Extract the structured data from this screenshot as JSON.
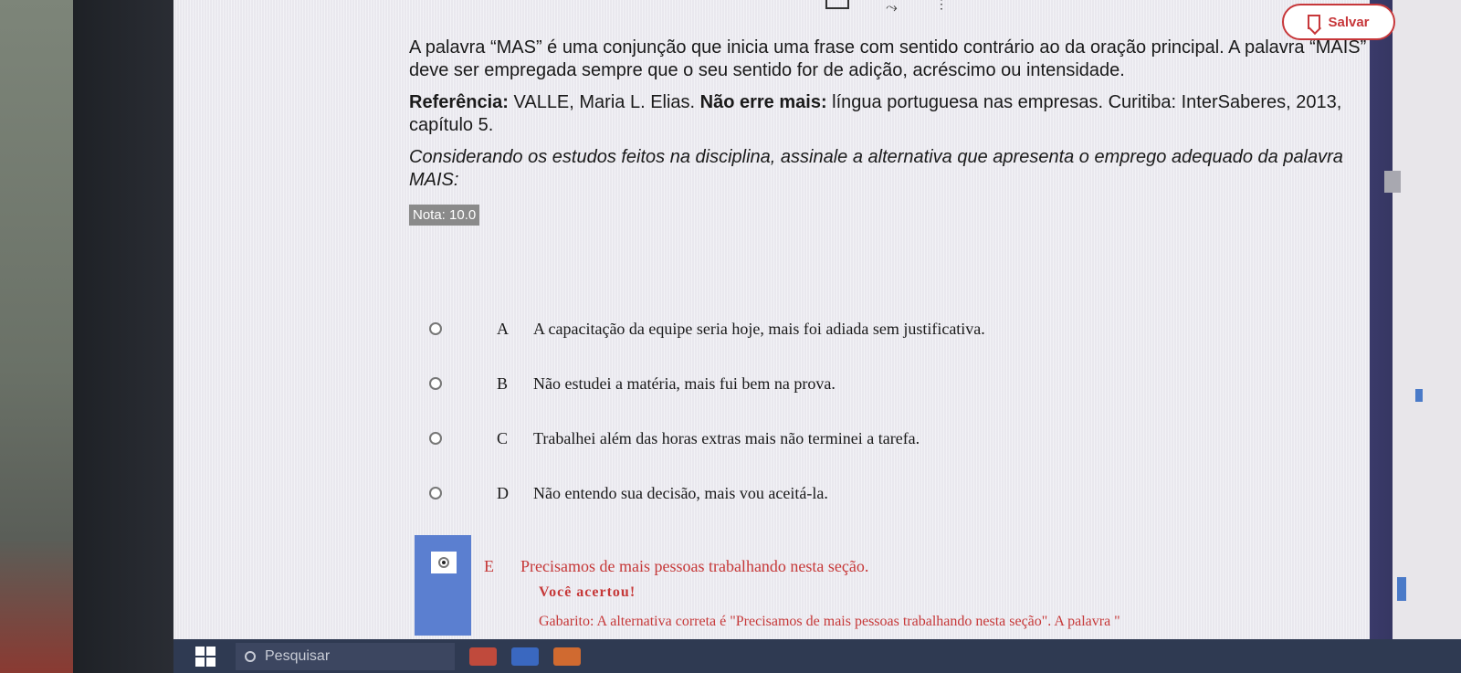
{
  "toolbar": {
    "save_label": "Salvar"
  },
  "question": {
    "para1": "A palavra “MAS” é uma conjunção que inicia uma frase com sentido contrário ao da oração principal. A palavra “MAIS” deve ser empregada sempre que o seu sentido for de adição, acréscimo ou intensidade.",
    "ref_label": "Referência:",
    "ref_author": " VALLE, Maria L. Elias. ",
    "ref_title": "Não erre mais:",
    "ref_rest": " língua portuguesa nas empresas. Curitiba: InterSaberes, 2013, capítulo 5.",
    "prompt": "Considerando os estudos feitos na disciplina, assinale a alternativa que apresenta o emprego adequado da palavra MAIS:",
    "nota": "Nota: 10.0"
  },
  "options": [
    {
      "letter": "A",
      "text": "A capacitação da equipe seria hoje, mais foi adiada sem justificativa."
    },
    {
      "letter": "B",
      "text": "Não estudei a matéria, mais fui bem na prova."
    },
    {
      "letter": "C",
      "text": "Trabalhei além das horas extras mais não terminei a tarefa."
    },
    {
      "letter": "D",
      "text": "Não entendo sua decisão, mais vou aceitá-la."
    },
    {
      "letter": "E",
      "text": "Precisamos de mais pessoas trabalhando nesta seção."
    }
  ],
  "feedback": {
    "result": "Você acertou!",
    "gabarito": "Gabarito: A alternativa correta é \"Precisamos de mais pessoas trabalhando nesta seção\". A palavra \""
  },
  "taskbar": {
    "search_placeholder": "Pesquisar"
  },
  "colors": {
    "accent": "#c7373a",
    "selected": "#5b7fd0"
  }
}
